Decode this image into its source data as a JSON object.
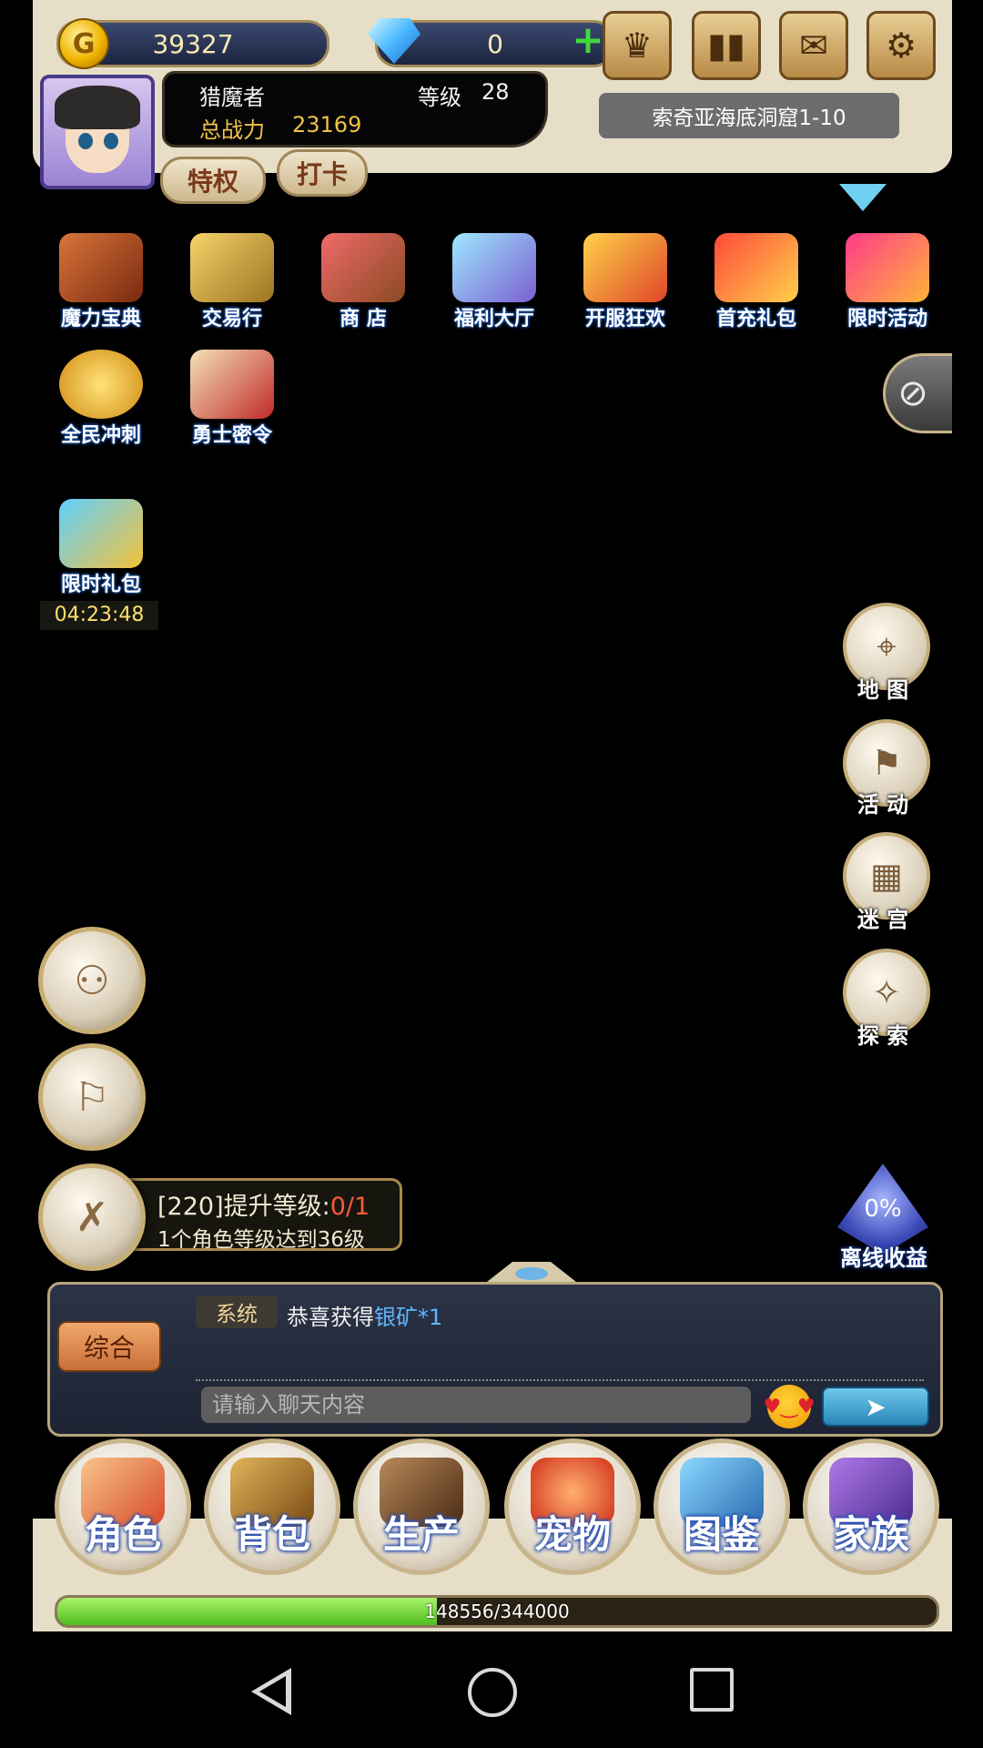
{
  "hud": {
    "gold": "39327",
    "gems": "0",
    "player_name": "猎魔者",
    "level_label": "等级",
    "level": "28",
    "power_label": "总战力",
    "power": "23169",
    "privilege_label": "特权",
    "checkin_label": "打卡",
    "location": "索奇亚海底洞窟1-10"
  },
  "features": [
    {
      "label": "魔力宝典"
    },
    {
      "label": "交易行"
    },
    {
      "label": "商 店"
    },
    {
      "label": "福利大厅"
    },
    {
      "label": "开服狂欢"
    },
    {
      "label": "首充礼包"
    },
    {
      "label": "限时活动"
    },
    {
      "label": "全民冲刺"
    },
    {
      "label": "勇士密令"
    },
    {
      "label": "限时礼包"
    }
  ],
  "gift_timer": "04:23:48",
  "right_buttons": [
    {
      "label": "地 图"
    },
    {
      "label": "活 动"
    },
    {
      "label": "迷 宫"
    },
    {
      "label": "探 索"
    }
  ],
  "quest": {
    "title": "[220]提升等级:",
    "progress": "0/1",
    "desc": "1个角色等级达到36级"
  },
  "offline": {
    "percent": "0%",
    "label": "离线收益"
  },
  "chat": {
    "tab": "综合",
    "channel": "系统",
    "message_prefix": "恭喜获得",
    "message_item": "银矿*1",
    "placeholder": "请输入聊天内容"
  },
  "bottom_nav": [
    {
      "label": "角色"
    },
    {
      "label": "背包"
    },
    {
      "label": "生产"
    },
    {
      "label": "宠物"
    },
    {
      "label": "图鉴"
    },
    {
      "label": "家族"
    }
  ],
  "exp": {
    "text": "148556/344000",
    "fraction": 0.432
  },
  "colors": {
    "gold_text": "#ffe9b5",
    "quest_progress": "#ff5a3a",
    "chat_highlight": "#5fb7ff",
    "exp_green": "#4fbe1d"
  }
}
